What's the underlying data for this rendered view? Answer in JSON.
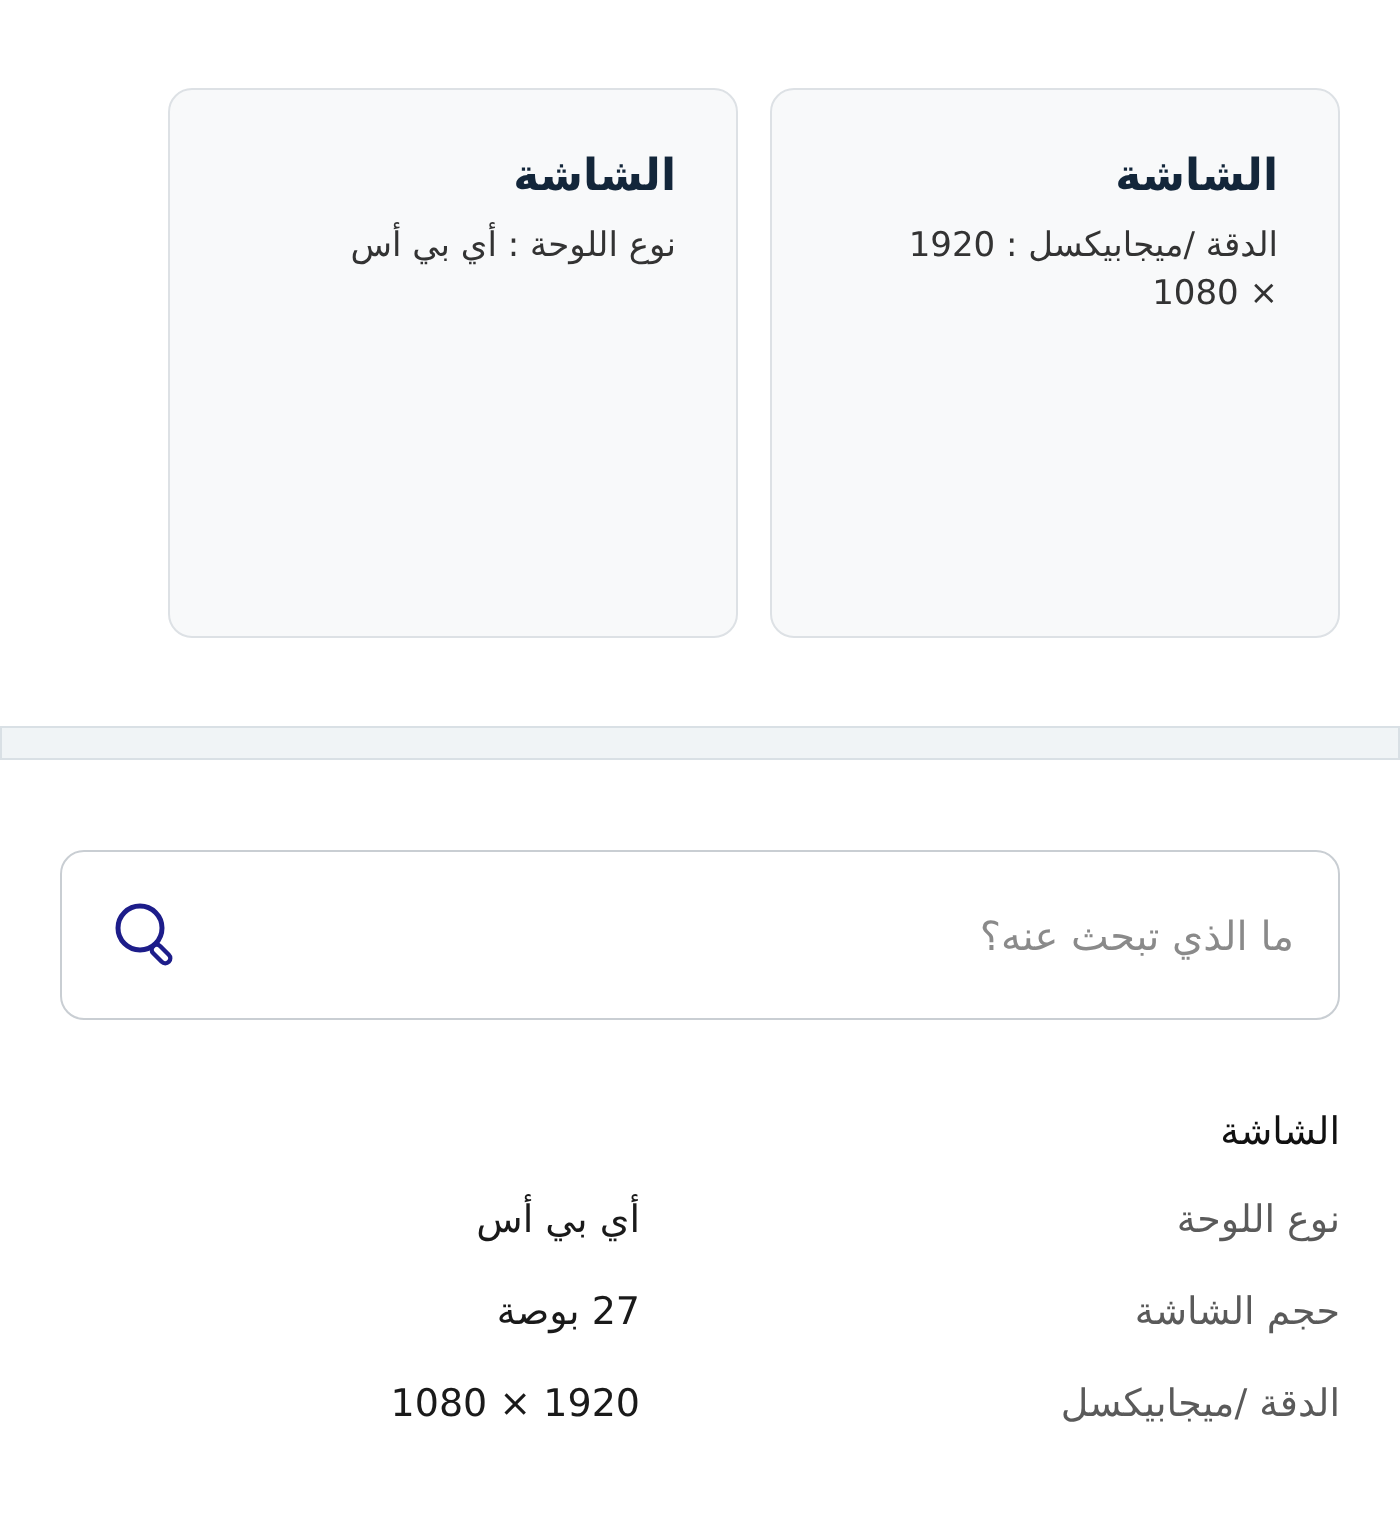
{
  "cards": [
    {
      "title": "الشاشة",
      "text": "الدقة /ميجابيكسل : 1920 × 1080"
    },
    {
      "title": "الشاشة",
      "text": "نوع اللوحة : أي بي أس"
    }
  ],
  "search": {
    "placeholder": "ما الذي تبحث عنه؟"
  },
  "specs": {
    "heading": "الشاشة",
    "rows": [
      {
        "label": "نوع اللوحة",
        "value": "أي بي أس"
      },
      {
        "label": "حجم الشاشة",
        "value": "27 بوصة"
      },
      {
        "label": "الدقة /ميجابيكسل",
        "value": "1920 × 1080"
      }
    ]
  }
}
